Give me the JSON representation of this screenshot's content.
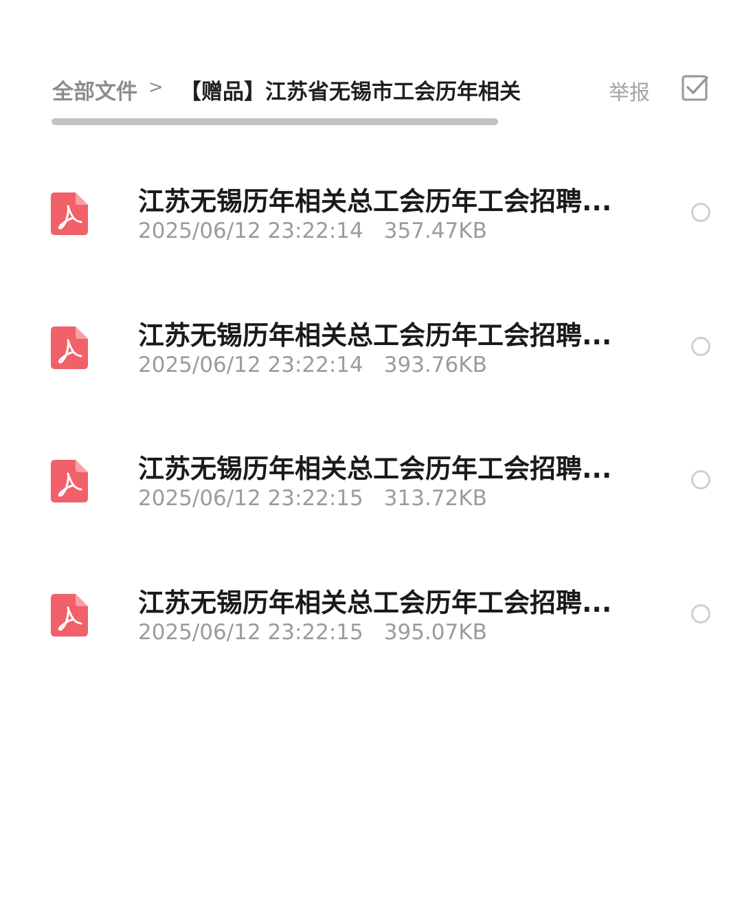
{
  "breadcrumb": {
    "root": "全部文件",
    "separator": ">",
    "current": "【赠品】江苏省无锡市工会历年相关"
  },
  "actions": {
    "report_label": "举报",
    "select_icon": "checkbox-icon"
  },
  "colors": {
    "pdf_icon": "#f0616a",
    "title_text": "#1a1a1a",
    "meta_text": "#9b9b9b",
    "breadcrumb_text": "#8c8c8c"
  },
  "files": [
    {
      "name": "江苏无锡历年相关总工会历年工会招聘...",
      "date": "2025/06/12 23:22:14",
      "size": "357.47KB",
      "icon": "pdf-icon",
      "selected": false
    },
    {
      "name": "江苏无锡历年相关总工会历年工会招聘...",
      "date": "2025/06/12 23:22:14",
      "size": "393.76KB",
      "icon": "pdf-icon",
      "selected": false
    },
    {
      "name": "江苏无锡历年相关总工会历年工会招聘...",
      "date": "2025/06/12 23:22:15",
      "size": "313.72KB",
      "icon": "pdf-icon",
      "selected": false
    },
    {
      "name": "江苏无锡历年相关总工会历年工会招聘...",
      "date": "2025/06/12 23:22:15",
      "size": "395.07KB",
      "icon": "pdf-icon",
      "selected": false
    }
  ]
}
